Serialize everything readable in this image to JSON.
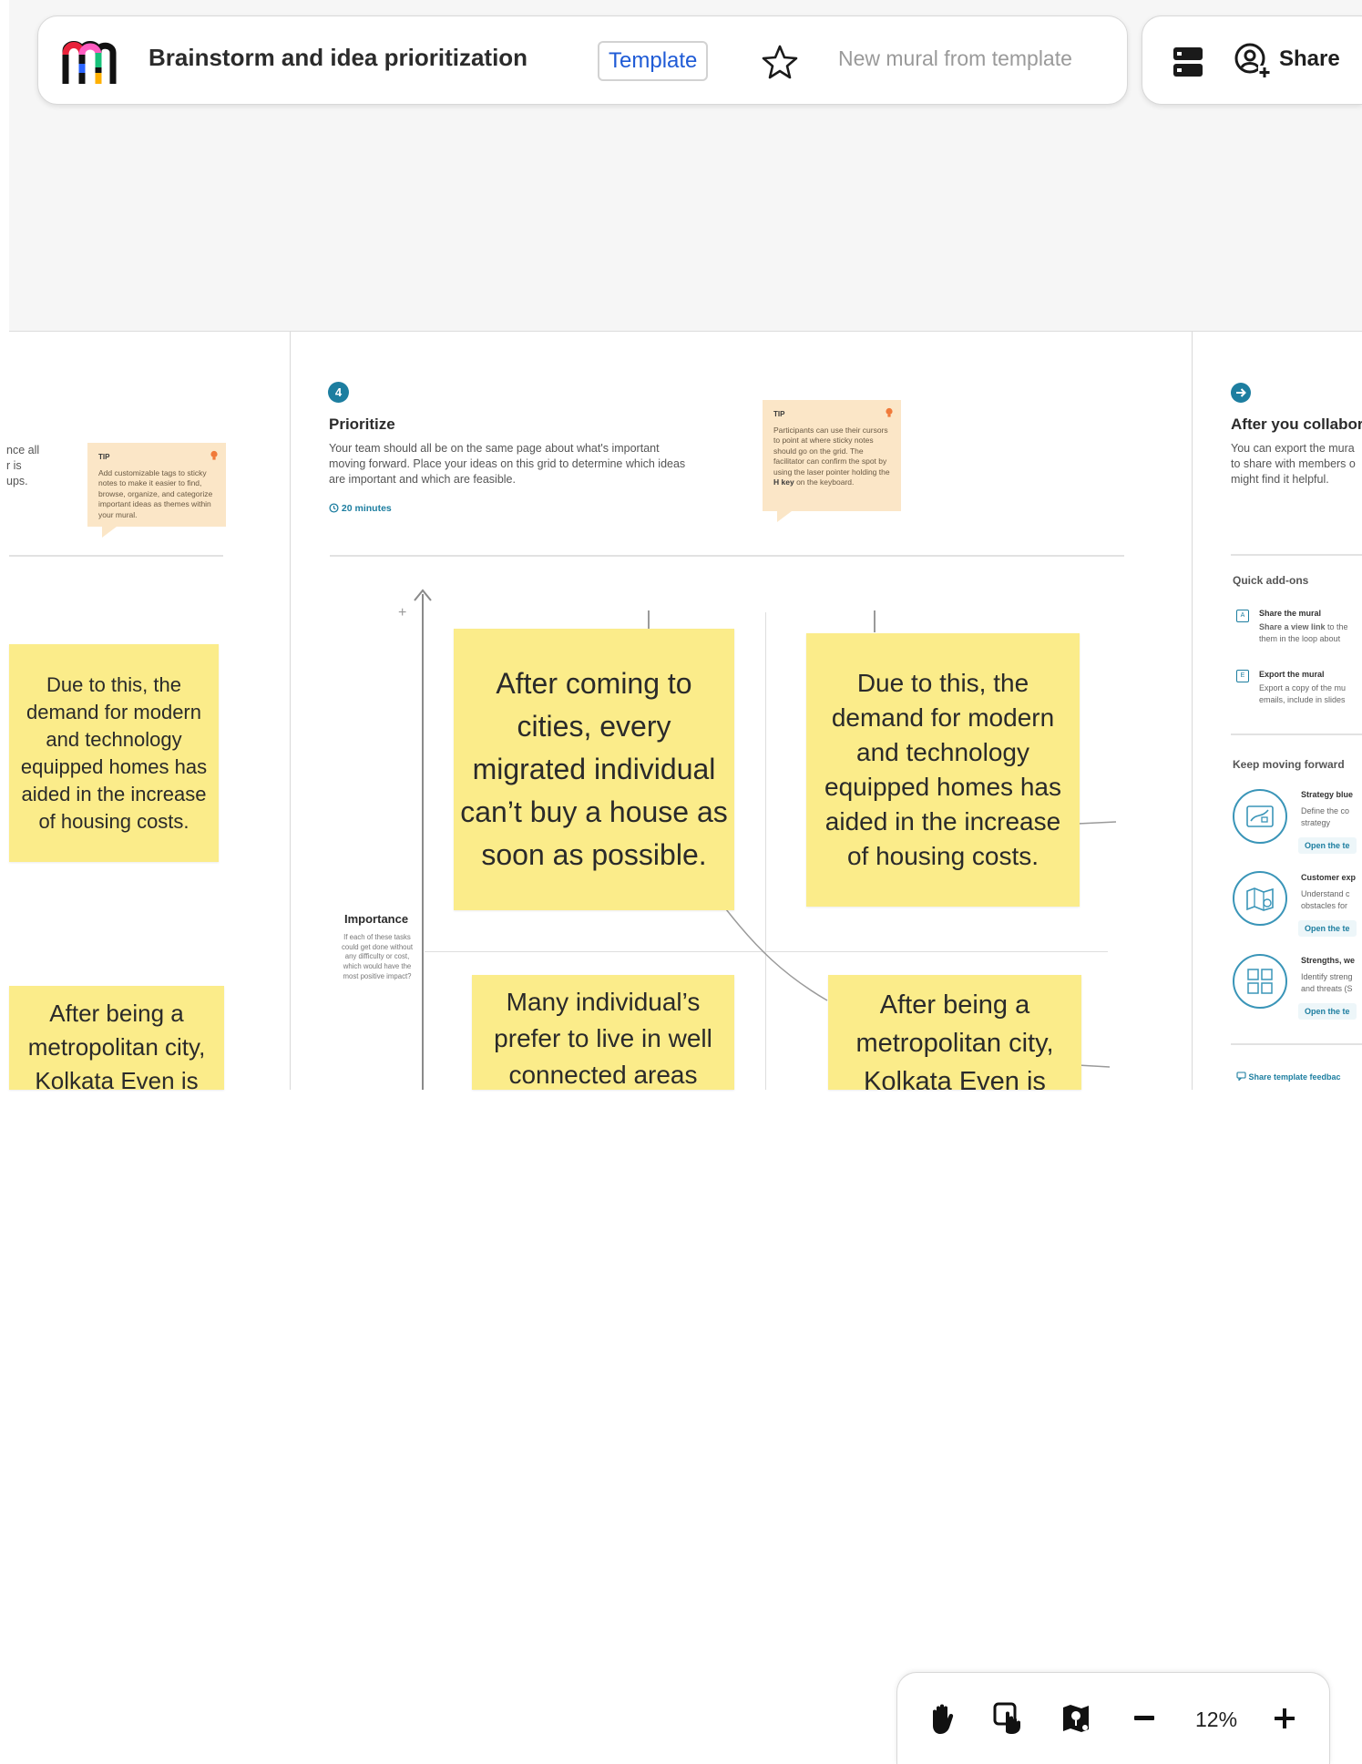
{
  "header": {
    "title": "Brainstorm and idea prioritization",
    "badge": "Template",
    "new_mural": "New mural from template",
    "share_label": "Share"
  },
  "left_section": {
    "desc_fragment": [
      "nce all",
      "r is",
      "ups."
    ],
    "tip": {
      "heading": "TIP",
      "body": "Add customizable tags to sticky notes to make it easier to find, browse, organize, and categorize important ideas as themes within your mural."
    }
  },
  "prioritize": {
    "step": "4",
    "title": "Prioritize",
    "description": "Your team should all be on the same page about what's important moving forward. Place your ideas on this grid to determine which ideas are important and which are feasible.",
    "time": "20 minutes",
    "tip": {
      "heading": "TIP",
      "body_pre": "Participants can use their cursors to point at where sticky notes should go on the grid. The facilitator can confirm the spot by using the laser pointer holding the",
      "key": "H key",
      "body_post": "on the keyboard."
    },
    "axis_plus": "+",
    "importance_label": "Importance",
    "importance_desc": "If each of these tasks could get done without any difficulty or cost, which would have the most positive impact?"
  },
  "stickies": [
    {
      "id": "left-1",
      "text": "Due to this, the demand for modern and technology equipped homes has aided in the increase of housing costs."
    },
    {
      "id": "left-2",
      "text": "After being a metropolitan city, Kolkata Even is"
    },
    {
      "id": "grid-1",
      "text": "After coming to cities, every migrated individual can’t buy a house as soon as possible."
    },
    {
      "id": "grid-2",
      "text": "Due to this, the demand for modern and technology equipped homes has aided in the increase of housing costs."
    },
    {
      "id": "grid-3",
      "text": "Many individual’s prefer to live in well connected areas"
    },
    {
      "id": "grid-4",
      "text": "After being a metropolitan city, Kolkata Even is"
    }
  ],
  "after": {
    "title": "After you collabor",
    "description_lines": [
      "You can export the mura",
      "to share with members o",
      "might find it helpful."
    ],
    "quick_addons_heading": "Quick add-ons",
    "addons": [
      {
        "icon": "A",
        "title": "Share the mural",
        "desc_bold": "Share a view link",
        "desc_rest": " to the",
        "desc2": "them in the loop about"
      },
      {
        "icon": "E",
        "title": "Export the mural",
        "desc": "Export a copy of the mu",
        "desc2": "emails, include in slides"
      }
    ],
    "keep_moving_heading": "Keep moving forward",
    "templates": [
      {
        "title": "Strategy blue",
        "desc1": "Define the co",
        "desc2": "strategy",
        "open": "Open the te"
      },
      {
        "title": "Customer exp",
        "desc1": "Understand c",
        "desc2": "obstacles for",
        "open": "Open the te"
      },
      {
        "title": "Strengths, we",
        "desc1": "Identify streng",
        "desc2": "and threats (S",
        "open": "Open the te"
      }
    ],
    "feedback": "Share template feedbac"
  },
  "zoom": {
    "level": "12%"
  },
  "colors": {
    "accent": "#1d7ea0",
    "sticky": "#fbec8a",
    "tip": "#fbe6c7",
    "badge_text": "#1f5bd6"
  },
  "icons": [
    "mural-logo-icon",
    "star-icon",
    "outline-icon",
    "share-user-icon",
    "lightbulb-icon",
    "clock-icon",
    "hand-icon",
    "touch-icon",
    "map-pin-icon",
    "minus-icon",
    "plus-icon"
  ]
}
